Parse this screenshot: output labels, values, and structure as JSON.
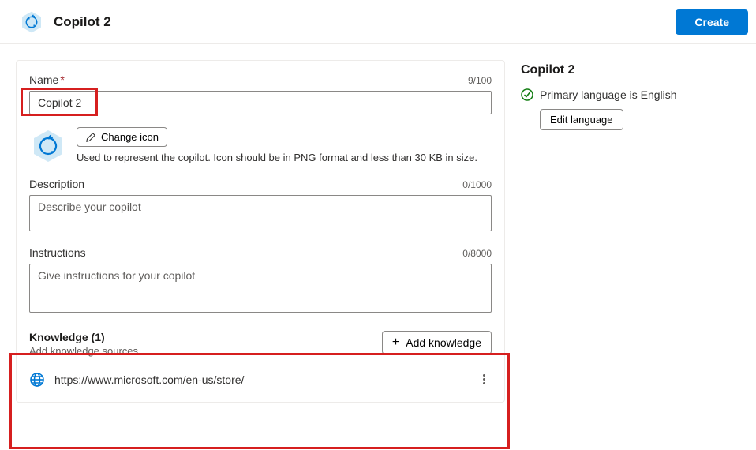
{
  "header": {
    "title": "Copilot 2",
    "create_label": "Create"
  },
  "form": {
    "name": {
      "label": "Name",
      "required": true,
      "value": "Copilot 2",
      "count": "9/100"
    },
    "icon": {
      "change_label": "Change icon",
      "hint": "Used to represent the copilot. Icon should be in PNG format and less than 30 KB in size."
    },
    "description": {
      "label": "Description",
      "placeholder": "Describe your copilot",
      "count": "0/1000"
    },
    "instructions": {
      "label": "Instructions",
      "placeholder": "Give instructions for your copilot",
      "count": "0/8000"
    },
    "knowledge": {
      "title": "Knowledge (1)",
      "subtitle": "Add knowledge sources",
      "add_label": "Add knowledge",
      "items": [
        {
          "url": "https://www.microsoft.com/en-us/store/"
        }
      ]
    }
  },
  "side": {
    "title": "Copilot 2",
    "language_status": "Primary language is English",
    "edit_language_label": "Edit language"
  }
}
